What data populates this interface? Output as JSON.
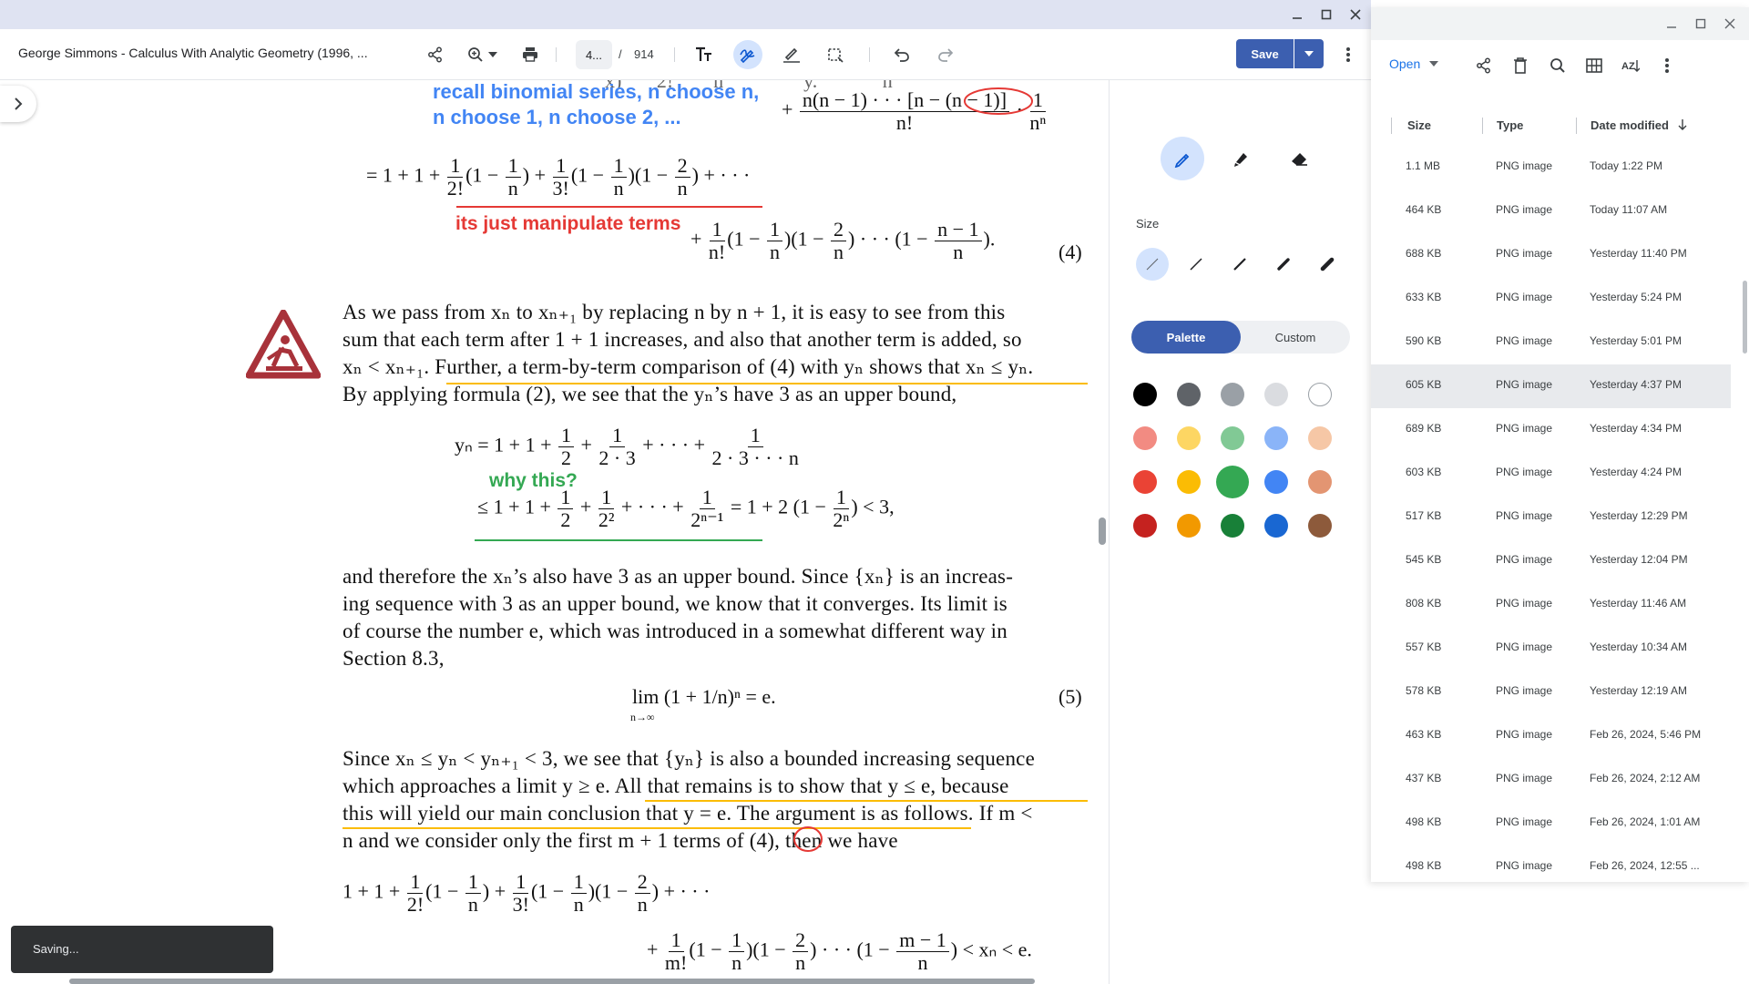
{
  "pdf": {
    "title": "George Simmons - Calculus With Analytic Geometry (1996, ...",
    "page_current": "4...",
    "page_sep": "/",
    "page_total": "914",
    "save_label": "Save",
    "toast": "Saving..."
  },
  "content": {
    "note_blue_1": "recall binomial series, n choose n,",
    "note_blue_2": "n choose 1, n choose 2, ...",
    "note_red": "its just manipulate terms",
    "note_green": "why this?",
    "para1_line1": "As we pass from xₙ to xₙ₊₁ by replacing n by n + 1, it is easy to see from this",
    "para1_line2": "sum that each term after 1 + 1 increases, and also that another term is added, so",
    "para1_line3": "xₙ < xₙ₊₁. Further, a term-by-term comparison of (4) with yₙ shows that xₙ ≤ yₙ.",
    "para1_line4": "By applying formula (2), we see that the yₙ’s have 3 as an upper bound,",
    "para2_line1": "and therefore the xₙ’s also have 3 as an upper bound. Since {xₙ} is an increas-",
    "para2_line2": "ing sequence with 3 as an upper bound, we know that it converges. Its limit is",
    "para2_line3": "of course the number e, which was introduced in a somewhat different way in",
    "para2_line4": "Section 8.3,",
    "para3_line1": "Since xₙ ≤ yₙ < yₙ₊₁ < 3, we see that {yₙ} is also a bounded increasing sequence",
    "para3_line2": "which approaches a limit y ≥ e. All that remains is to show that y ≤ e, because",
    "para3_line3": "this will yield our main conclusion that y = e. The argument is as follows. If m <",
    "para3_line4": "n and we consider only the first m + 1 terms of (4), then we have",
    "eq4_label": "(4)",
    "eq5_label": "(5)",
    "eq5": "lim (1 + 1/n)ⁿ = e.",
    "eq5_sub": "n→∞"
  },
  "panel": {
    "size_label": "Size",
    "palette_label": "Palette",
    "custom_label": "Custom",
    "colors": [
      [
        "#000000",
        "#5f6368",
        "#9aa0a6",
        "#dadce0",
        "#ffffff"
      ],
      [
        "#f28b82",
        "#fdd663",
        "#81c995",
        "#8ab4f8",
        "#f6c7a6"
      ],
      [
        "#ea4335",
        "#fbbc04",
        "#34a853",
        "#4285f4",
        "#e39572"
      ],
      [
        "#c5221f",
        "#f29900",
        "#188038",
        "#1967d2",
        "#8d5a3b"
      ]
    ]
  },
  "files": {
    "open_label": "Open",
    "col_size": "Size",
    "col_type": "Type",
    "col_date": "Date modified",
    "rows": [
      {
        "size": "1.1 MB",
        "type": "PNG image",
        "date": "Today 1:22 PM"
      },
      {
        "size": "464 KB",
        "type": "PNG image",
        "date": "Today 11:07 AM"
      },
      {
        "size": "688 KB",
        "type": "PNG image",
        "date": "Yesterday 11:40 PM"
      },
      {
        "size": "633 KB",
        "type": "PNG image",
        "date": "Yesterday 5:24 PM"
      },
      {
        "size": "590 KB",
        "type": "PNG image",
        "date": "Yesterday 5:01 PM"
      },
      {
        "size": "605 KB",
        "type": "PNG image",
        "date": "Yesterday 4:37 PM"
      },
      {
        "size": "689 KB",
        "type": "PNG image",
        "date": "Yesterday 4:34 PM"
      },
      {
        "size": "603 KB",
        "type": "PNG image",
        "date": "Yesterday 4:24 PM"
      },
      {
        "size": "517 KB",
        "type": "PNG image",
        "date": "Yesterday 12:29 PM"
      },
      {
        "size": "545 KB",
        "type": "PNG image",
        "date": "Yesterday 12:04 PM"
      },
      {
        "size": "808 KB",
        "type": "PNG image",
        "date": "Yesterday 11:46 AM"
      },
      {
        "size": "557 KB",
        "type": "PNG image",
        "date": "Yesterday 10:34 AM"
      },
      {
        "size": "578 KB",
        "type": "PNG image",
        "date": "Yesterday 12:19 AM"
      },
      {
        "size": "463 KB",
        "type": "PNG image",
        "date": "Feb 26, 2024, 5:46 PM"
      },
      {
        "size": "437 KB",
        "type": "PNG image",
        "date": "Feb 26, 2024, 2:12 AM"
      },
      {
        "size": "498 KB",
        "type": "PNG image",
        "date": "Feb 26, 2024, 1:01 AM"
      },
      {
        "size": "498 KB",
        "type": "PNG image",
        "date": "Feb 26, 2024, 12:55 ..."
      }
    ],
    "selected_index": 5
  }
}
